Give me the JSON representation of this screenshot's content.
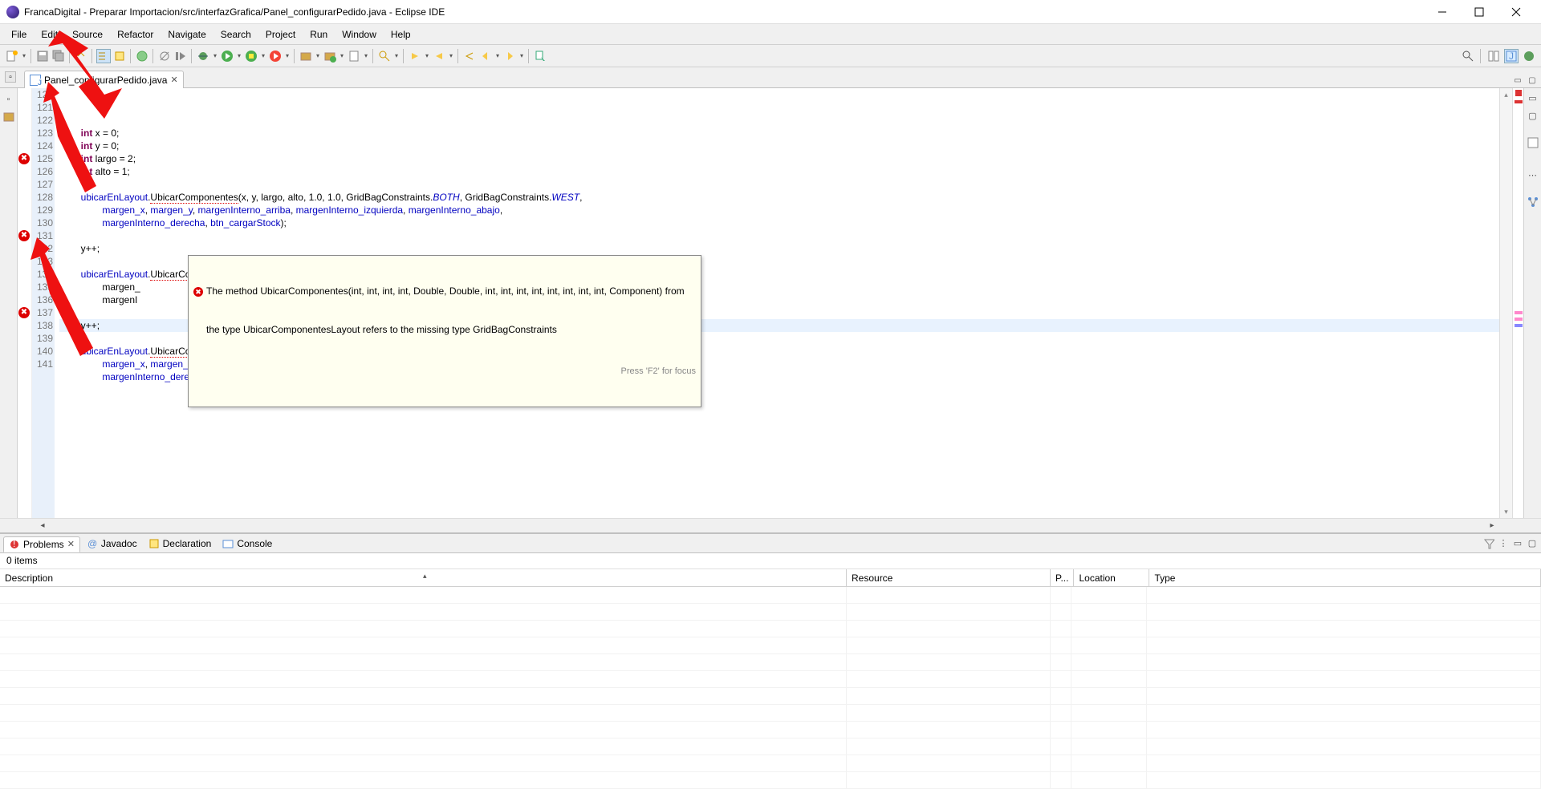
{
  "window": {
    "title": "FrancaDigital - Preparar Importacion/src/interfazGrafica/Panel_configurarPedido.java - Eclipse IDE"
  },
  "menu": [
    "File",
    "Edit",
    "Source",
    "Refactor",
    "Navigate",
    "Search",
    "Project",
    "Run",
    "Window",
    "Help"
  ],
  "editor_tab": {
    "label": "Panel_configurarPedido.java"
  },
  "code": {
    "lines": [
      {
        "n": 120,
        "html": "        <span class='kw'>int</span> x = 0;"
      },
      {
        "n": 121,
        "html": "        <span class='kw'>int</span> y = 0;"
      },
      {
        "n": 122,
        "html": "        <span class='kw'>int</span> largo = 2;"
      },
      {
        "n": 123,
        "html": "        <span class='kw'>int</span> alto = 1;"
      },
      {
        "n": 124,
        "html": ""
      },
      {
        "n": 125,
        "html": "        <span class='fld'>ubicarEnLayout</span>.<span class='err-underline'>UbicarComponentes</span>(x, y, largo, alto, 1.0, 1.0, GridBagConstraints.<span class='sit'>BOTH</span>, GridBagConstraints.<span class='sit'>WEST</span>,",
        "err": true
      },
      {
        "n": 126,
        "html": "                <span class='fld'>margen_x</span>, <span class='fld'>margen_y</span>, <span class='fld'>margenInterno_arriba</span>, <span class='fld'>margenInterno_izquierda</span>, <span class='fld'>margenInterno_abajo</span>,"
      },
      {
        "n": 127,
        "html": "                <span class='fld'>margenInterno_derecha</span>, <span class='fld'>btn_cargarStock</span>);"
      },
      {
        "n": 128,
        "html": ""
      },
      {
        "n": 129,
        "html": "        y++;"
      },
      {
        "n": 130,
        "html": ""
      },
      {
        "n": 131,
        "html": "        <span class='fld'>ubicarEnLayout</span>.<span class='err-underline'>UbicarComponentes</span>(x, y, largo, alto, 1.0, 1.0, GridBagConstraints.<span class='sit'>BOTH</span>, GridBagConstraints.<span class='sit'>WEST</span>,",
        "err": true
      },
      {
        "n": 132,
        "html": "                margen_"
      },
      {
        "n": 133,
        "html": "                margenI"
      },
      {
        "n": 134,
        "html": ""
      },
      {
        "n": 135,
        "html": "        y++;",
        "hl": true
      },
      {
        "n": 136,
        "html": ""
      },
      {
        "n": 137,
        "html": "        <span class='fld'>ubicarEnLayout</span>.<span class='err-underline'>UbicarComponentes</span>(x, y, largo, alto, 1.0, 1.0, GridBagConstraints.<span class='sit'>BOTH</span>, GridBagConstraints.<span class='sit'>WEST</span>,",
        "err": true
      },
      {
        "n": 138,
        "html": "                <span class='fld'>margen_x</span>, <span class='fld'>margen_y</span>, <span class='fld'>margenInterno_arriba</span>, <span class='fld'>margenInterno_izquierda</span>, <span class='fld'>margenInterno_abajo</span>,"
      },
      {
        "n": 139,
        "html": "                <span class='fld'>margenInterno_derecha</span>, <span class='fld'>btn_agregarPeriodosRatio</span>);"
      },
      {
        "n": 140,
        "html": ""
      }
    ],
    "display_nums": [
      120,
      121,
      122,
      123,
      124,
      125,
      126,
      127,
      128,
      129,
      130,
      131,
      132,
      133,
      134,
      135,
      136,
      137,
      138,
      139,
      140,
      141
    ]
  },
  "tooltip": {
    "text1": "The method UbicarComponentes(int, int, int, int, Double, Double, int, int, int, int, int, int, int, int, Component) from",
    "text2": "the type UbicarComponentesLayout refers to the missing type GridBagConstraints",
    "hint": "Press 'F2' for focus"
  },
  "problems": {
    "tabs": [
      {
        "label": "Problems",
        "active": true,
        "icon": "problems-icon"
      },
      {
        "label": "Javadoc",
        "active": false,
        "icon": "javadoc-icon"
      },
      {
        "label": "Declaration",
        "active": false,
        "icon": "declaration-icon"
      },
      {
        "label": "Console",
        "active": false,
        "icon": "console-icon"
      }
    ],
    "count_label": "0 items",
    "columns": {
      "description": "Description",
      "resource": "Resource",
      "path": "P...",
      "location": "Location",
      "type": "Type"
    }
  }
}
